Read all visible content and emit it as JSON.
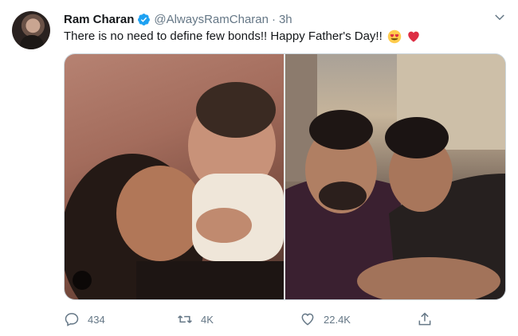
{
  "tweet": {
    "author_name": "Ram Charan",
    "handle": "@AlwaysRamCharan",
    "separator": "·",
    "time": "3h",
    "text": "There is no need to define few bonds!! Happy Father's Day!!",
    "emojis": [
      "smiling-face-with-heart-eyes",
      "red-heart"
    ],
    "media": [
      {
        "description_icon": "photo-left"
      },
      {
        "description_icon": "photo-right"
      }
    ]
  },
  "actions": {
    "reply_count": "434",
    "retweet_count": "4K",
    "like_count": "22.4K"
  },
  "colors": {
    "verified_blue": "#1da1f2",
    "secondary_text": "#657786",
    "heart_red": "#e0245e"
  }
}
